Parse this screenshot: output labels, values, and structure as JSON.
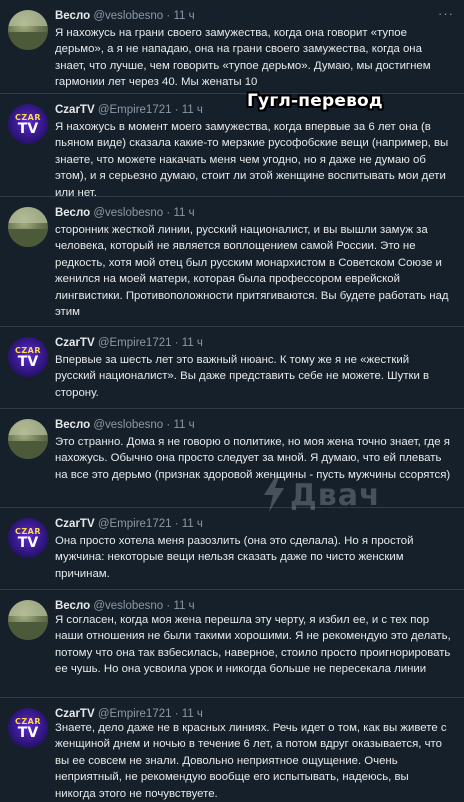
{
  "overlay_caption": "Гугл-перевод",
  "watermark": "Двач",
  "tweets": [
    {
      "name": "Весло",
      "handle": "@veslobesno",
      "dot": "·",
      "time": "11 ч",
      "text": "Я нахожусь на грани своего замужества, когда она говорит «тупое дерьмо», а я не нападаю, она на грани своего замужества, когда она знает, что лучше, чем говорить «тупое дерьмо». Думаю, мы достигнем гармонии лет через 40. Мы женаты 10"
    },
    {
      "name": "CzarTV",
      "handle": "@Empire1721",
      "dot": "·",
      "time": "11 ч",
      "text": "Я нахожусь в момент моего замужества, когда впервые за 6 лет она (в пьяном виде) сказала какие-то мерзкие русофобские вещи (например, вы знаете, что можете накачать меня чем угодно, но я даже не думаю об этом), и я серьезно думаю, стоит ли этой женщине воспитывать мои дети или нет."
    },
    {
      "name": "Весло",
      "handle": "@veslobesno",
      "dot": "·",
      "time": "11 ч",
      "text": "сторонник жесткой линии, русский националист, и вы вышли замуж за человека, который не является воплощением самой России. Это не редкость, хотя мой отец был русским монархистом в Советском Союзе и женился на моей матери, которая была профессором еврейской лингвистики. Противоположности притягиваются. Вы будете работать над этим"
    },
    {
      "name": "CzarTV",
      "handle": "@Empire1721",
      "dot": "·",
      "time": "11 ч",
      "text": "Впервые за шесть лет это важный нюанс. К тому же я не «жесткий русский националист». Вы даже представить себе не можете. Шутки в сторону."
    },
    {
      "name": "Весло",
      "handle": "@veslobesno",
      "dot": "·",
      "time": "11 ч",
      "text": "Это странно. Дома я не говорю о политике, но моя жена точно знает, где я нахожусь. Обычно она просто следует за мной. Я думаю, что ей плевать на все это дерьмо (признак здоровой женщины - пусть мужчины ссорятся)"
    },
    {
      "name": "CzarTV",
      "handle": "@Empire1721",
      "dot": "·",
      "time": "11 ч",
      "text": "Она просто хотела меня разозлить (она это сделала). Но я простой мужчина: некоторые вещи нельзя сказать даже по чисто женским причинам."
    },
    {
      "name": "Весло",
      "handle": "@veslobesno",
      "dot": "·",
      "time": "11 ч",
      "text": "Я согласен, когда моя жена перешла эту черту, я избил ее, и с тех пор наши отношения не были такими хорошими. Я не рекомендую это делать, потому что она так взбесилась, наверное, стоило просто проигнорировать ее чушь. Но она усвоила урок и никогда больше не пересекала линии"
    },
    {
      "name": "CzarTV",
      "handle": "@Empire1721",
      "dot": "·",
      "time": "11 ч",
      "text": "Знаете, дело даже не в красных линиях. Речь идет о том, как вы живете с женщиной днем и ночью в течение 6 лет, а потом вдруг оказывается, что вы ее совсем не знали. Довольно неприятное ощущение. Очень неприятный, не рекомендую вообще его испытывать, надеюсь, вы никогда этого не почувствуете."
    }
  ],
  "avatar_czar_top": "CZAR",
  "avatar_czar_bottom": "TV",
  "more_glyph": "···"
}
